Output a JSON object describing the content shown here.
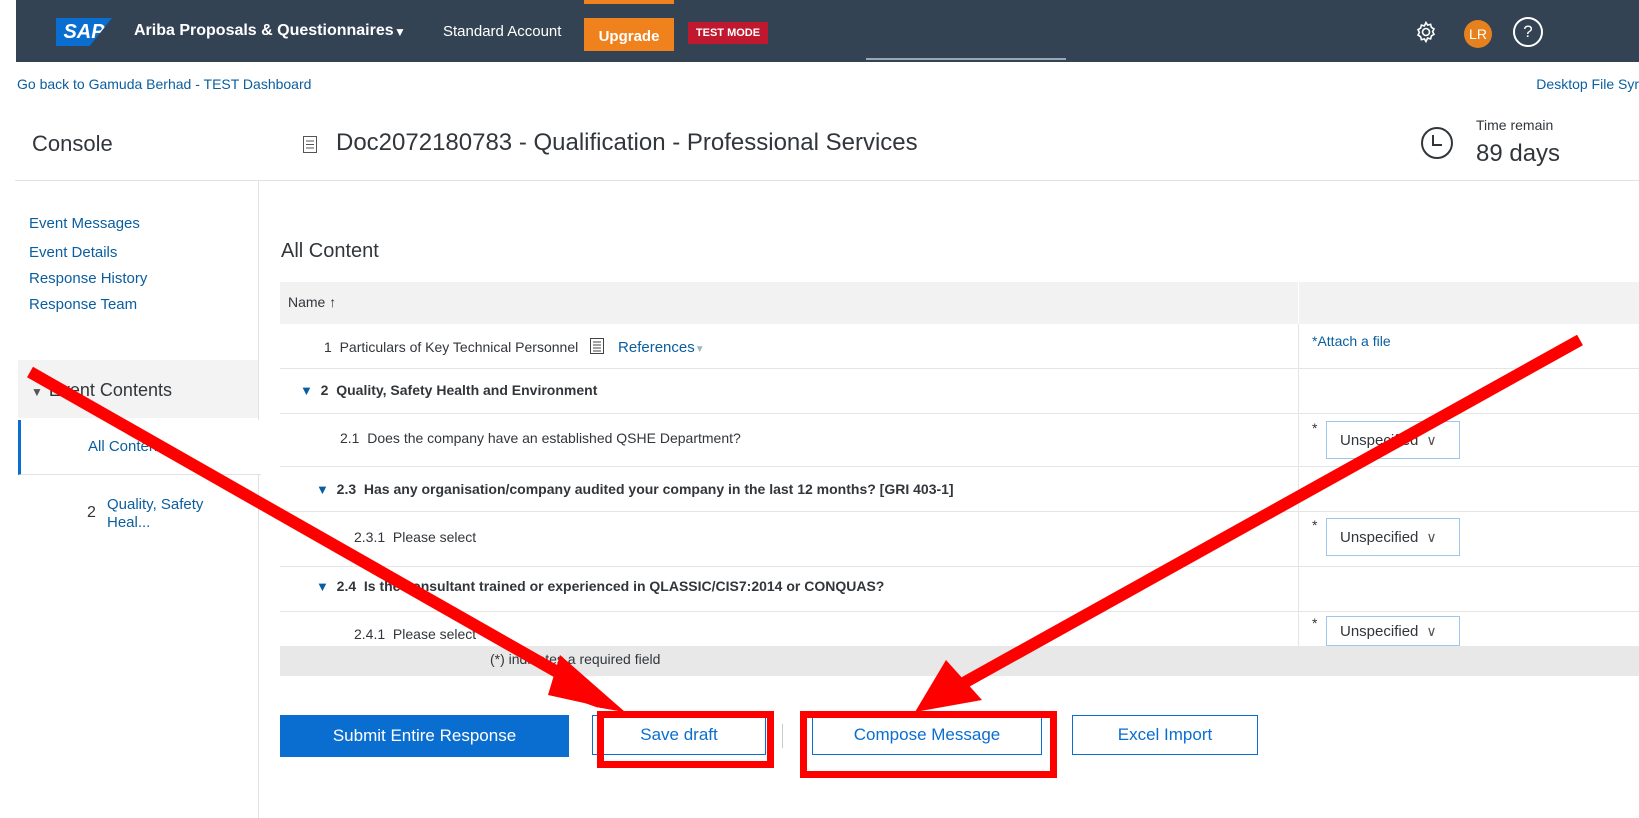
{
  "topbar": {
    "logo_text": "SAP",
    "app_title": "Ariba Proposals & Questionnaires",
    "account_label": "Standard Account",
    "upgrade_label": "Upgrade",
    "test_mode_label": "TEST MODE",
    "avatar_initials": "LR",
    "help_glyph": "?"
  },
  "nav": {
    "back_link": "Go back to Gamuda Berhad - TEST Dashboard",
    "desktop_sync": "Desktop File Syr"
  },
  "header": {
    "console_title": "Console",
    "doc_title": "Doc2072180783 - Qualification - Professional Services",
    "time_label": "Time remain",
    "time_value": "89 days"
  },
  "sidebar": {
    "links": [
      "Event Messages",
      "Event Details",
      "Response History",
      "Response Team"
    ],
    "event_contents_label": "Event Contents",
    "all_content_label": "All Content",
    "item2_number": "2",
    "item2_label": "Quality, Safety Heal..."
  },
  "main": {
    "title": "All Content",
    "col_name": "Name ↑",
    "rows": [
      {
        "num": "1",
        "text": "Particulars of Key Technical Personnel",
        "link": "References",
        "attach": "Attach a file"
      },
      {
        "num": "2",
        "text": "Quality, Safety Health and Environment"
      },
      {
        "num": "2.1",
        "text": "Does the company have an established QSHE Department?",
        "select": "Unspecified"
      },
      {
        "num": "2.3",
        "text": "Has any organisation/company audited your company in the last 12 months? [GRI 403-1]"
      },
      {
        "num": "2.3.1",
        "text": "Please select",
        "select": "Unspecified"
      },
      {
        "num": "2.4",
        "text": "Is the consultant trained or experienced in QLASSIC/CIS7:2014 or CONQUAS?"
      },
      {
        "num": "2.4.1",
        "text": "Please select",
        "select": "Unspecified"
      }
    ],
    "required_note": "(*) indicates a required field",
    "required_star": "*"
  },
  "buttons": {
    "submit": "Submit Entire Response",
    "save_draft": "Save draft",
    "compose": "Compose Message",
    "excel_import": "Excel Import"
  },
  "colors": {
    "topbar": "#344354",
    "accent": "#0a6ed1",
    "upgrade": "#f0821e",
    "test_mode": "#c0182e",
    "annotation": "#ff0000"
  },
  "icons": {
    "gear": "gear-icon",
    "clock": "clock-icon",
    "document": "document-icon",
    "caret": "caret-down-icon",
    "chevron": "chevron-down-icon"
  }
}
